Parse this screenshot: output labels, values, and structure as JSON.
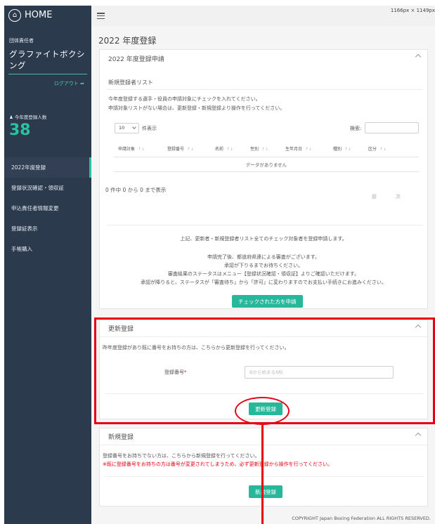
{
  "sidebar": {
    "home_label": "HOME",
    "group_label": "団体責任者",
    "group_name": "グラファイトボクシング",
    "logout": "ログアウト ➦",
    "count_label": "♟ 今年度登録人数",
    "count_value": "38",
    "menu": [
      {
        "label": "2022年度登録"
      },
      {
        "label": "登録状況確認・領収証"
      },
      {
        "label": "申込責任者情報変更"
      },
      {
        "label": "登録証表示"
      },
      {
        "label": "手帳購入"
      }
    ]
  },
  "topbar": {
    "dims": "1166px × 1149px"
  },
  "page_title": "2022 年度登録",
  "apply_card": {
    "header": "2022 年度登録申請",
    "list_title": "新規登録者リスト",
    "desc1": "今年度登録する選手・役員の申請対象にチェックを入れてください。",
    "desc2": "申請対象リストがない場合は、更新登録・新規登録より操作を行ってください。",
    "page_length": "10",
    "show_label": "件表示",
    "search_label": "検索:",
    "columns": [
      "申請対象",
      "登録番号",
      "名前",
      "性別",
      "生年月日",
      "種別",
      "区分"
    ],
    "empty": "データがありません",
    "info": "0 件中 0 から 0 まで表示",
    "prev": "前",
    "next": "次",
    "notice": "上記、更新者・新規登録者リスト全てのチェック対象者を登録申請します。",
    "notes": [
      "申請完了後、都道府県連による審査がございます。",
      "承認が下りるまでお待ちください。",
      "審査結果のステータスはメニュー【登録状況確認・領収証】よりご確認いただけます。",
      "承認が降りると、ステータスが「審査待ち」から「許可」に変わりますのでお支払い手続きにお進みください。"
    ],
    "submit": "チェックされた方を申請"
  },
  "renew_card": {
    "header": "更新登録",
    "desc": "昨年度登録があり既に番号をお持ちの方は、こちらから更新登録を行ってください。",
    "field_label": "登録番号",
    "required_mark": "*",
    "placeholder": "Bから始まる6桁",
    "button": "更新登録"
  },
  "new_card": {
    "header": "新規登録",
    "desc1": "登録番号をお持ちでない方は、こちらから新規登録を行ってください。",
    "desc2": "※既に登録番号をお持ちの方は番号が変更されてしまうため、必ず更新登録から操作を行ってください。",
    "button": "新規登録"
  },
  "footer": "COPYRIGHT Japan Boxing Federation ALL RIGHTS RESERVED.",
  "colors": {
    "accent": "#27b89b",
    "sidebar": "#2c3a4e",
    "annotation": "#e60012"
  }
}
